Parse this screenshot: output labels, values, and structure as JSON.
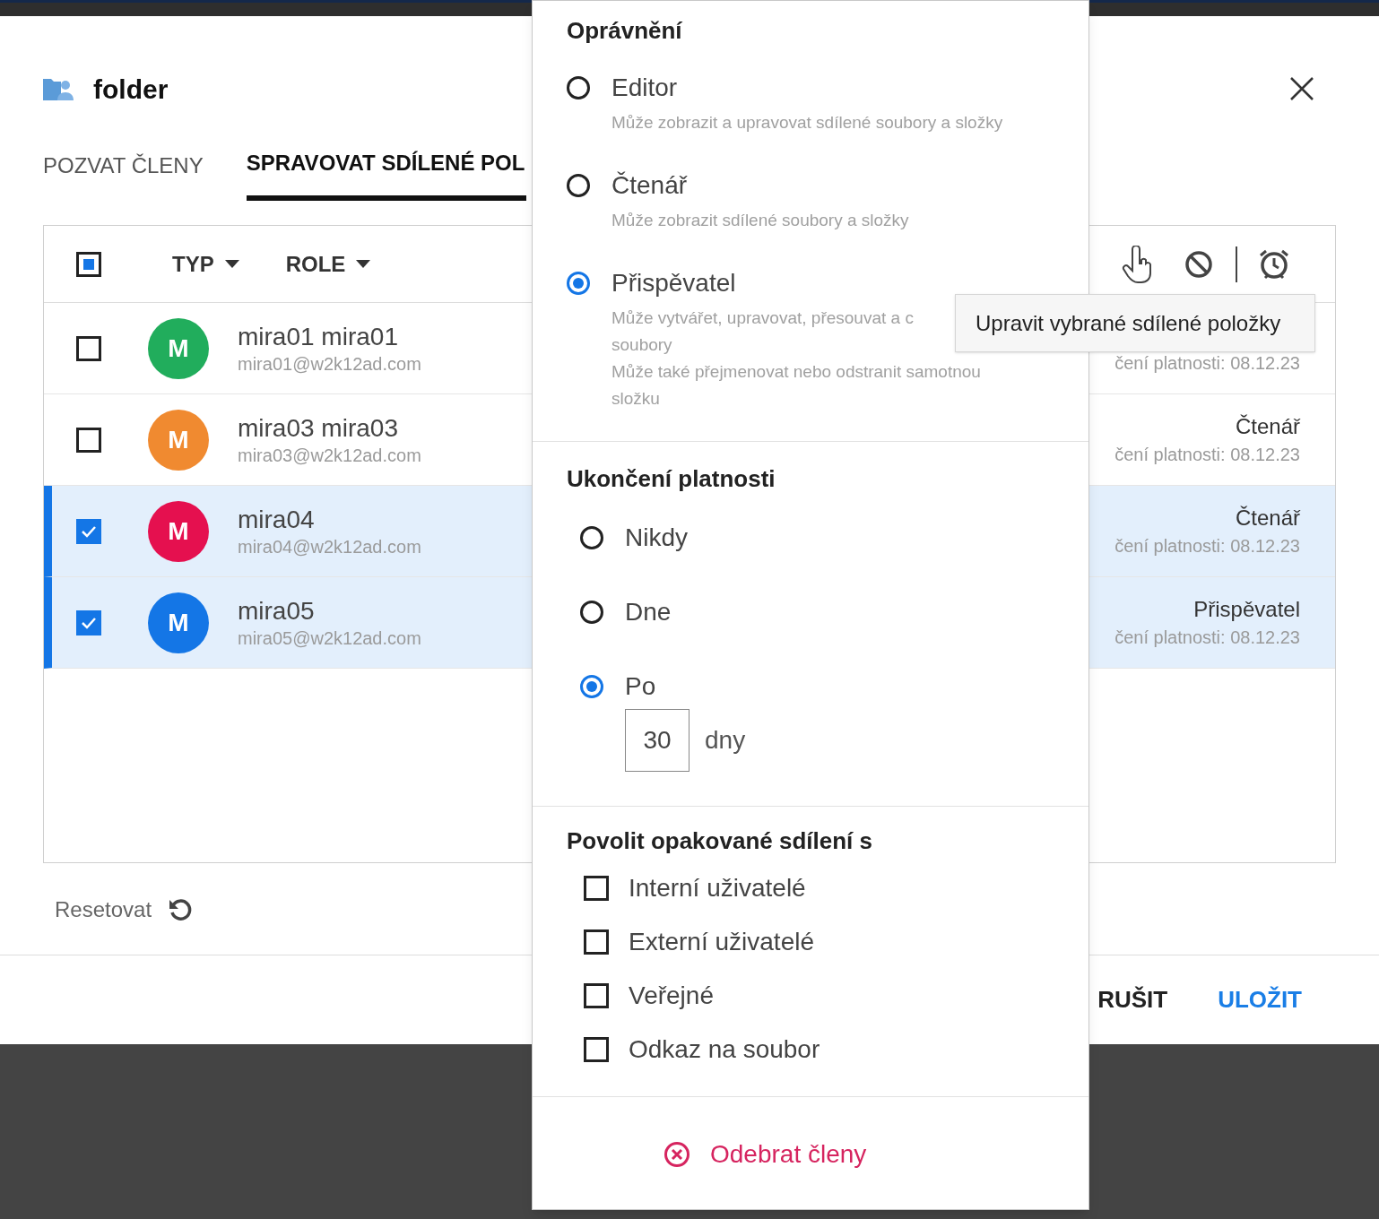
{
  "dialog": {
    "title": "folder",
    "tabs": [
      {
        "label": "POZVAT ČLENY",
        "selected": false
      },
      {
        "label": "SPRAVOVAT SDÍLENÉ POL",
        "selected": true
      }
    ],
    "table": {
      "header_checkbox": {
        "indeterminate": true
      },
      "columns": [
        {
          "label": "TYP"
        },
        {
          "label": "ROLE"
        }
      ],
      "rows": [
        {
          "initial": "M",
          "color": "#21ad5c",
          "name": "mira01 mira01",
          "email": "mira01@w2k12ad.com",
          "expiry": "čení platnosti: 08.12.23",
          "selected": false
        },
        {
          "initial": "M",
          "color": "#f08a30",
          "name": "mira03 mira03",
          "email": "mira03@w2k12ad.com",
          "role": "Čtenář",
          "expiry": "čení platnosti: 08.12.23",
          "selected": false
        },
        {
          "initial": "M",
          "color": "#e5104f",
          "name": "mira04",
          "email": "mira04@w2k12ad.com",
          "role": "Čtenář",
          "expiry": "čení platnosti: 08.12.23",
          "selected": true
        },
        {
          "initial": "M",
          "color": "#1476e6",
          "name": "mira05",
          "email": "mira05@w2k12ad.com",
          "role": "Přispěvatel",
          "expiry": "čení platnosti: 08.12.23",
          "selected": true
        }
      ]
    },
    "reset": {
      "label": "Resetovat"
    },
    "buttons": [
      {
        "label": "RUŠIT",
        "kind": "secondary"
      },
      {
        "label": "ULOŽIT",
        "kind": "primary"
      }
    ]
  },
  "popover": {
    "permissions": {
      "title": "Oprávnění",
      "options": [
        {
          "label": "Editor",
          "description": [
            "Může zobrazit a upravovat sdílené soubory a složky"
          ],
          "selected": false
        },
        {
          "label": "Čtenář",
          "description": [
            "Může zobrazit sdílené soubory a složky"
          ],
          "selected": false
        },
        {
          "label": "Přispěvatel",
          "description": [
            "Může vytvářet, upravovat, přesouvat a c",
            "soubory",
            "Může také přejmenovat nebo odstranit samotnou",
            "složku"
          ],
          "selected": true
        }
      ]
    },
    "expiry": {
      "title": "Ukončení platnosti",
      "options": [
        {
          "label": "Nikdy",
          "selected": false
        },
        {
          "label": "Dne",
          "selected": false
        },
        {
          "label": "Po",
          "selected": true,
          "input": {
            "value": "30",
            "unit": "dny"
          }
        }
      ]
    },
    "reshare": {
      "title": "Povolit opakované sdílení s",
      "options": [
        {
          "label": "Interní uživatelé",
          "checked": false
        },
        {
          "label": "Externí uživatelé",
          "checked": false
        },
        {
          "label": "Veřejné",
          "checked": false
        },
        {
          "label": "Odkaz na soubor",
          "checked": false
        }
      ]
    },
    "remove": {
      "label": "Odebrat členy"
    }
  },
  "tooltip": {
    "text": "Upravit vybrané sdílené položky"
  }
}
